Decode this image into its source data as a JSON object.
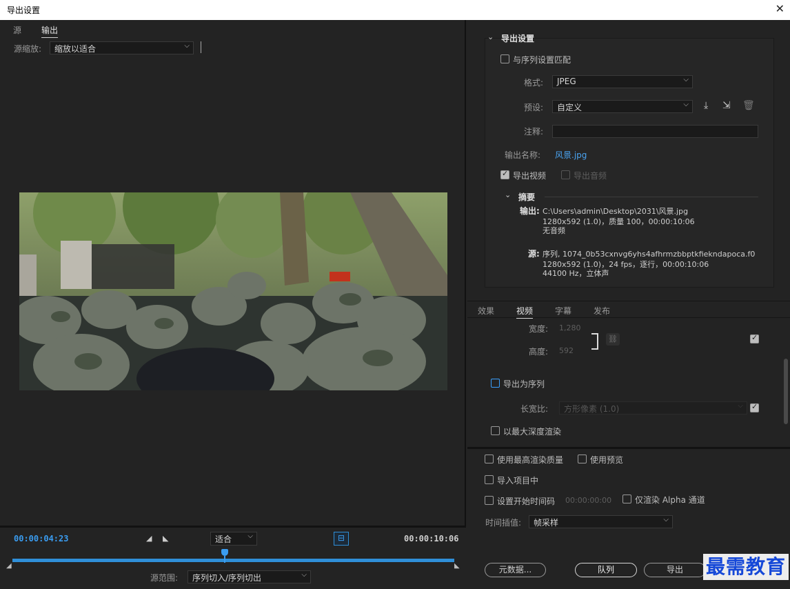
{
  "window": {
    "title": "导出设置"
  },
  "left": {
    "tabs": [
      {
        "label": "源"
      },
      {
        "label": "输出"
      }
    ],
    "source_scale_label": "源缩放:",
    "source_scale_value": "缩放以适合",
    "current_time": "00:00:04:23",
    "fit_value": "适合",
    "end_time": "00:00:10:06",
    "source_range_label": "源范围:",
    "source_range_value": "序列切入/序列切出",
    "playhead_fraction": 0.48
  },
  "export": {
    "section_title": "导出设置",
    "match_sequence": "与序列设置匹配",
    "format_label": "格式:",
    "format_value": "JPEG",
    "preset_label": "预设:",
    "preset_value": "自定义",
    "comment_label": "注释:",
    "comment_value": "",
    "output_name_label": "输出名称:",
    "output_name_value": "风景.jpg",
    "export_video": "导出视频",
    "export_audio": "导出音频",
    "summary_title": "摘要",
    "output_label": "输出:",
    "output_lines": [
      "C:\\Users\\admin\\Desktop\\2031\\风景.jpg",
      "1280x592 (1.0)，质量 100，00:00:10:06",
      "无音频"
    ],
    "source_label": "源:",
    "source_lines": [
      "序列, 1074_0b53cxnvg6yhs4afhrmzbbptkfiekndapoca.f0",
      "1280x592 (1.0)，24 fps，逐行，00:00:10:06",
      "44100 Hz，立体声"
    ]
  },
  "tabs2": [
    {
      "label": "效果"
    },
    {
      "label": "视频"
    },
    {
      "label": "字幕"
    },
    {
      "label": "发布"
    }
  ],
  "video": {
    "width_label": "宽度:",
    "width_value": "1,280",
    "height_label": "高度:",
    "height_value": "592",
    "export_as_sequence": "导出为序列",
    "aspect_label": "长宽比:",
    "aspect_value": "方形像素 (1.0)",
    "max_depth": "以最大深度渲染"
  },
  "bottom": {
    "max_quality": "使用最高渲染质量",
    "use_preview": "使用预览",
    "import_project": "导入项目中",
    "set_start_tc": "设置开始时间码",
    "start_tc_value": "00:00:00:00",
    "alpha_only": "仅渲染 Alpha 通道",
    "interp_label": "时间插值:",
    "interp_value": "帧采样",
    "metadata_btn": "元数据...",
    "queue_btn": "队列",
    "export_btn": "导出"
  },
  "watermark": "最需教育"
}
